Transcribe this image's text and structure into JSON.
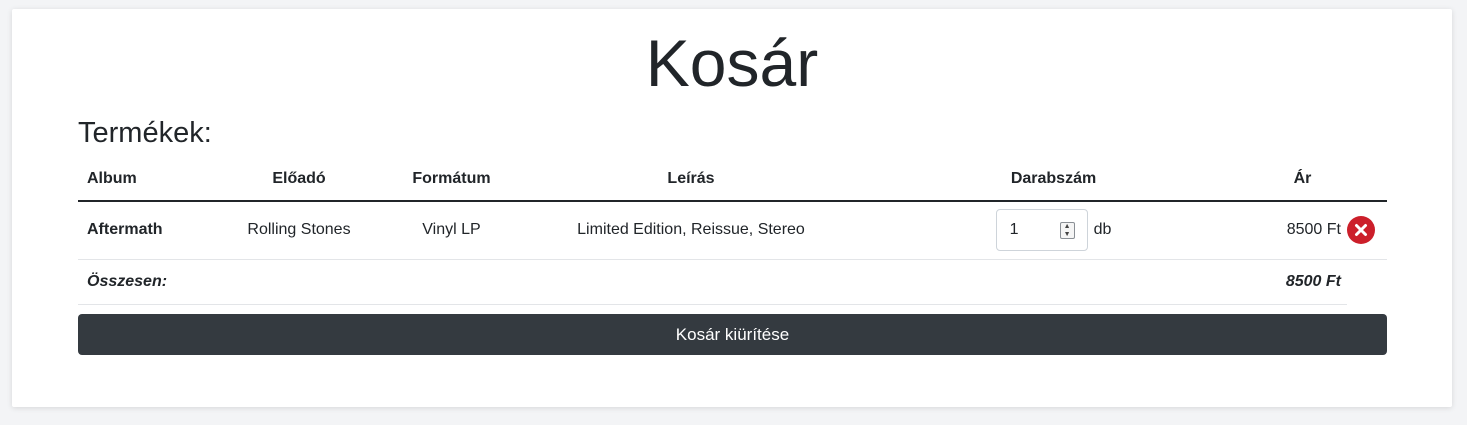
{
  "page": {
    "title": "Kosár"
  },
  "products": {
    "heading": "Termékek:"
  },
  "table": {
    "headers": {
      "album": "Album",
      "artist": "Előadó",
      "format": "Formátum",
      "description": "Leírás",
      "quantity": "Darabszám",
      "price": "Ár"
    },
    "rows": [
      {
        "album": "Aftermath",
        "artist": "Rolling Stones",
        "format": "Vinyl LP",
        "description": "Limited Edition, Reissue, Stereo",
        "quantity": "1",
        "quantity_unit": "db",
        "price": "8500 Ft"
      }
    ],
    "total_label": "Összesen:",
    "total_value": "8500 Ft"
  },
  "actions": {
    "clear_cart_label": "Kosár kiürítése"
  },
  "icons": {
    "remove": "close-circle-icon",
    "spinner_up": "chevron-up-icon",
    "spinner_down": "chevron-down-icon"
  },
  "colors": {
    "remove_button": "#cc1f2a",
    "clear_button": "#343a40",
    "background": "#f3f4f6"
  }
}
